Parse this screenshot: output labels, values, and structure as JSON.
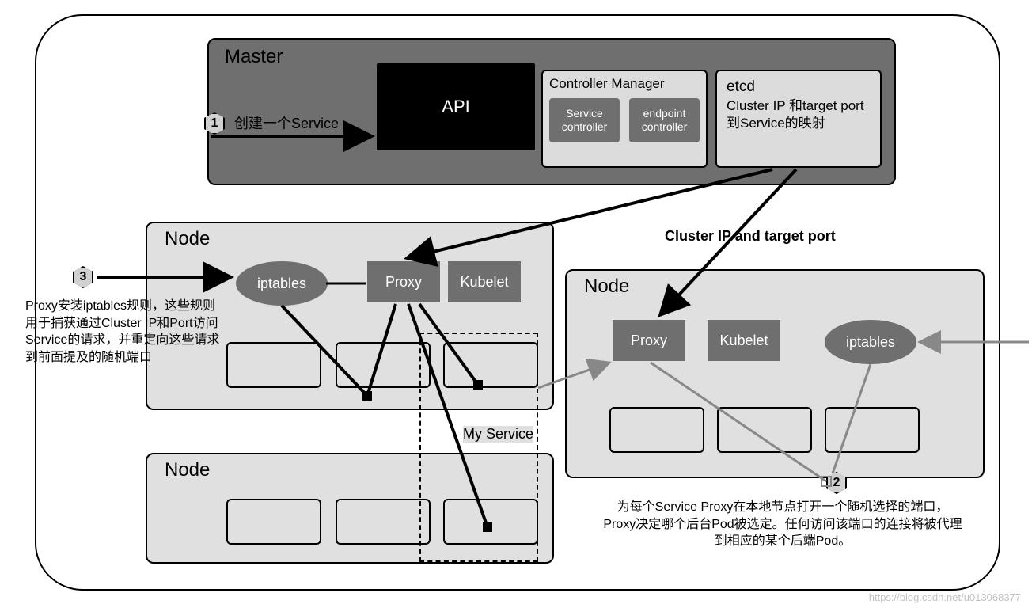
{
  "master": {
    "title": "Master",
    "api": "API",
    "controller_manager": {
      "title": "Controller Manager",
      "items": [
        "Service controller",
        "endpoint controller"
      ]
    },
    "etcd": {
      "title": "etcd",
      "desc": "Cluster IP 和target port 到Service的映射"
    }
  },
  "nodes": {
    "title": "Node",
    "iptables": "iptables",
    "proxy": "Proxy",
    "kubelet": "Kubelet"
  },
  "service_label": "My Service",
  "cluster_ip_label": "Cluster IP and target port",
  "steps": {
    "1": {
      "num": "1",
      "text": "创建一个Service"
    },
    "2": {
      "num": "2",
      "text": "为每个Service Proxy在本地节点打开一个随机选择的端口，Proxy决定哪个后台Pod被选定。任何访问该端口的连接将被代理到相应的某个后端Pod。"
    },
    "3": {
      "num": "3",
      "text": "Proxy安装iptables规则，这些规则用于捕获通过Cluster IP和Port访问Service的请求，并重定向这些请求到前面提及的随机端口"
    }
  },
  "watermark": "https://blog.csdn.net/u013068377"
}
